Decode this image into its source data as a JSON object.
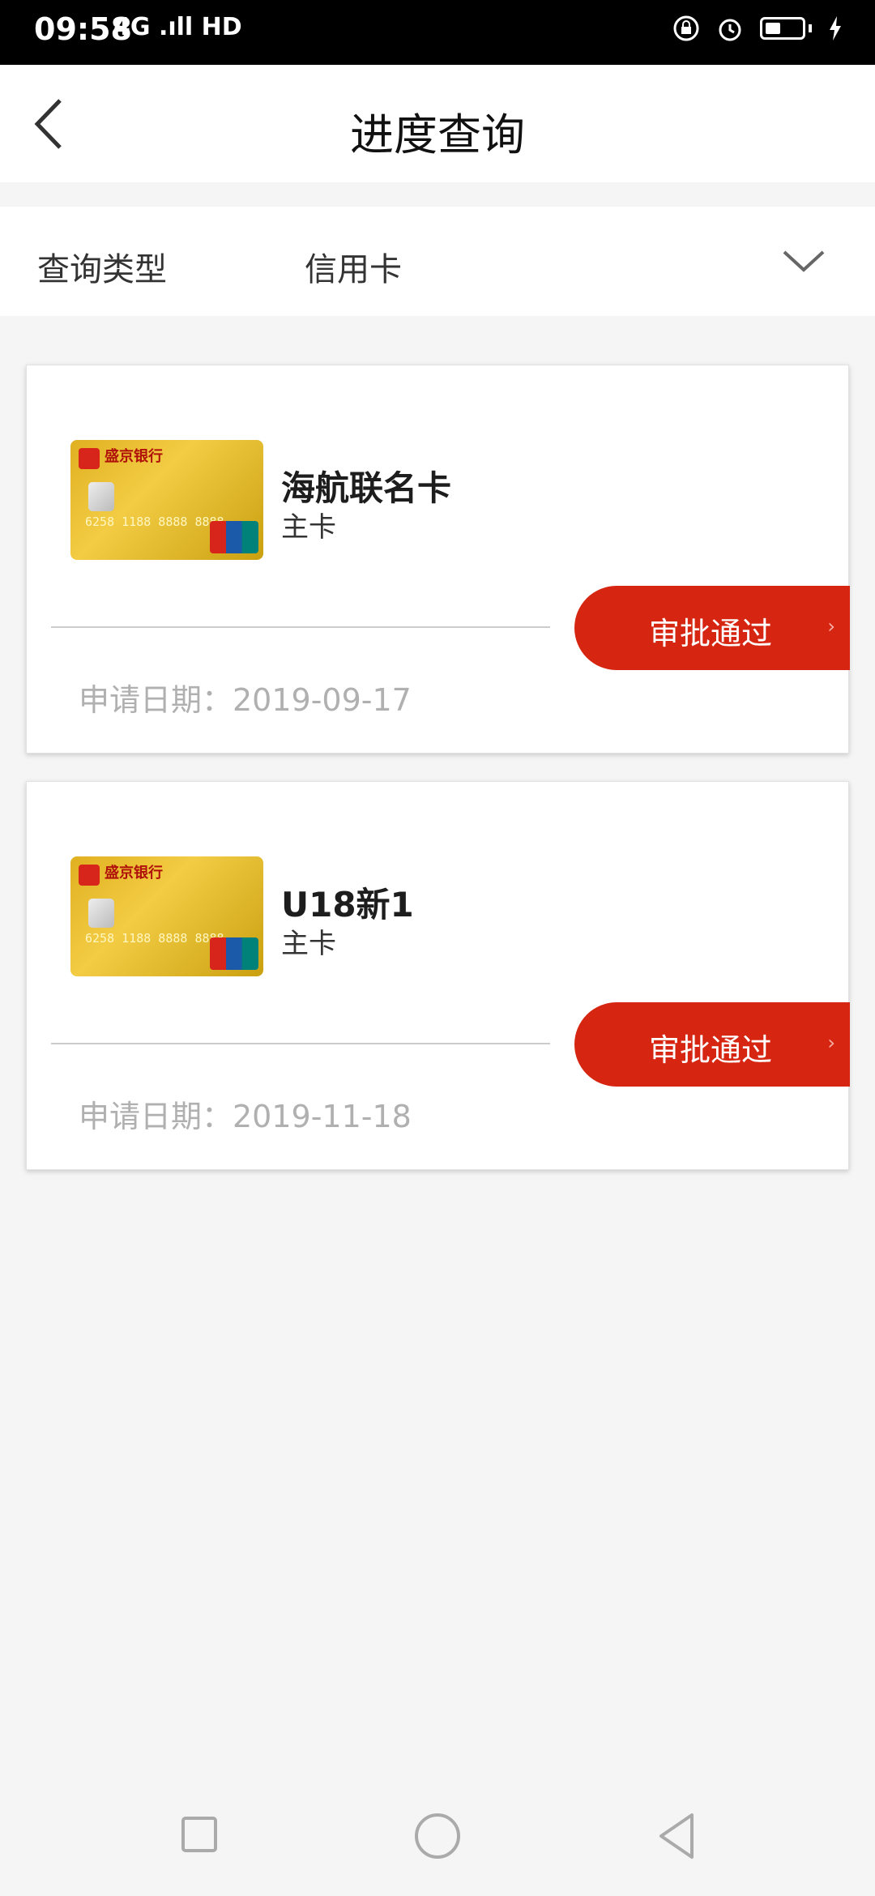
{
  "status_bar": {
    "time": "09:58",
    "network": "4G .ıll HD"
  },
  "header": {
    "title": "进度查询"
  },
  "filter": {
    "label": "查询类型",
    "value": "信用卡"
  },
  "applications": [
    {
      "card_name": "海航联名卡",
      "card_type": "主卡",
      "status": "审批通过",
      "date": "申请日期：2019-09-17",
      "card_art": {
        "bank_name": "盛京银行",
        "number": "6258 1188 8888 8888"
      }
    },
    {
      "card_name": "U18新1",
      "card_type": "主卡",
      "status": "审批通过",
      "date": "申请日期：2019-11-18",
      "card_art": {
        "bank_name": "盛京银行",
        "number": "6258 1188 8888 8888"
      }
    }
  ],
  "colors": {
    "accent": "#d62511",
    "background": "#f5f5f5",
    "card_gold": "#e0b020"
  }
}
